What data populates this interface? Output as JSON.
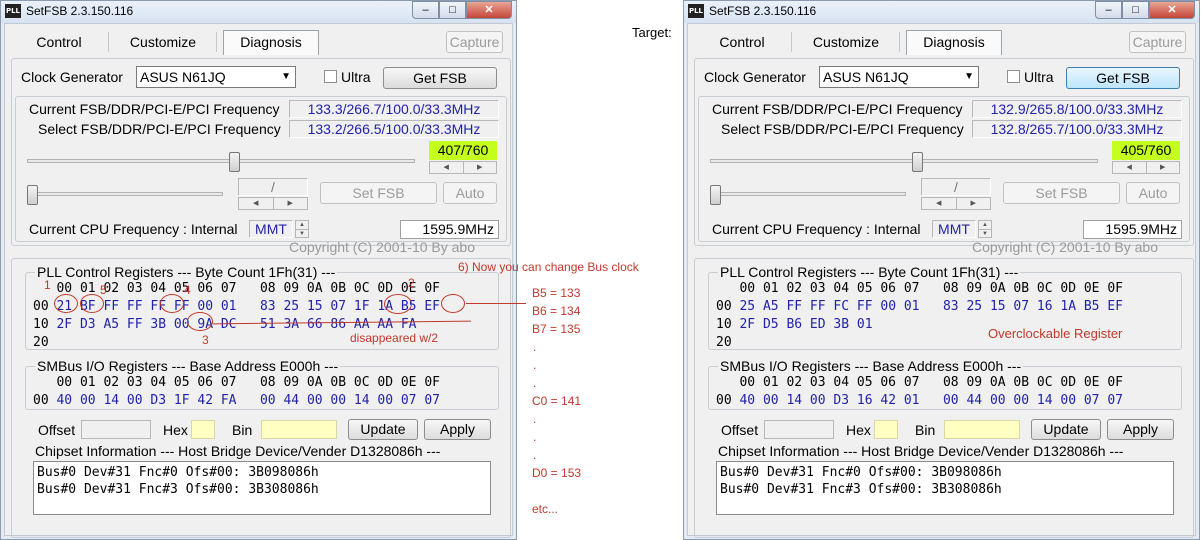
{
  "title_icon": "PLL",
  "window_title": "SetFSB 2.3.150.116",
  "target_label": "Target:",
  "tabs": [
    "Control",
    "Customize",
    "Diagnosis"
  ],
  "capture": "Capture",
  "clock_gen_label": "Clock Generator",
  "clock_gen_value": "ASUS N61JQ",
  "ultra_label": "Ultra",
  "get_fsb": "Get FSB",
  "cur_freq_label": "Current FSB/DDR/PCI-E/PCI Frequency",
  "sel_freq_label": "Select FSB/DDR/PCI-E/PCI Frequency",
  "slash": "/",
  "set_fsb": "Set FSB",
  "auto": "Auto",
  "cpu_label": "Current CPU Frequency : Internal",
  "mmt": "MMT",
  "copyright": "Copyright (C) 2001-10 By abo",
  "pll_header": "PLL Control Registers  --- Byte Count 1Fh(31) ---",
  "col_header": "   00 01 02 03 04 05 06 07   08 09 0A 0B 0C 0D 0E 0F",
  "smbus_header": "SMBus I/O Registers  --- Base Address E000h ---",
  "offset_label": "Offset",
  "hex_label": "Hex",
  "bin_label": "Bin",
  "update": "Update",
  "apply": "Apply",
  "chipset_header": "Chipset Information  --- Host Bridge Device/Vender D1328086h ---",
  "chipset_lines": [
    "Bus#0 Dev#31 Fnc#0 Ofs#00: 3B098086h",
    "Bus#0 Dev#31 Fnc#3 Ofs#00: 3B308086h"
  ],
  "left": {
    "cur_freq": "133.3/266.7/100.0/33.3MHz",
    "sel_freq": "133.2/266.5/100.0/33.3MHz",
    "fsb_count": "407/760",
    "cpu_freq": "1595.9MHz",
    "pll_rows": [
      {
        "addr": "00",
        "values": "21 BF FF FF FF FF 00 01   83 25 15 07 1F 1A B5 EF"
      },
      {
        "addr": "10",
        "values": "2F D3 A5 FF 3B 00 9A DC   51 3A 66 86 AA AA FA"
      },
      {
        "addr": "20",
        "values": ""
      }
    ],
    "smbus_row": {
      "addr": "00",
      "values": "40 00 14 00 D3 1F 42 FA   00 44 00 00 14 00 07 07"
    }
  },
  "right": {
    "cur_freq": "132.9/265.8/100.0/33.3MHz",
    "sel_freq": "132.8/265.7/100.0/33.3MHz",
    "fsb_count": "405/760",
    "cpu_freq": "1595.9MHz",
    "pll_rows": [
      {
        "addr": "00",
        "values": "25 A5 FF FF FC FF 00 01   83 25 15 07 16 1A B5 EF"
      },
      {
        "addr": "10",
        "values": "2F D5 B6 ED 3B 01"
      },
      {
        "addr": "20",
        "values": ""
      }
    ],
    "smbus_row": {
      "addr": "00",
      "values": "40 00 14 00 D3 16 42 01   00 44 00 00 14 00 07 07"
    }
  },
  "annotations": {
    "n1": "1",
    "n2": "2",
    "n3": "3",
    "n4": "4",
    "n5": "5",
    "step6": "6) Now you can change Bus clock",
    "disappeared": "disappeared w/2",
    "overclockable": "Overclockable Register",
    "b5": "B5 = 133",
    "b6": "B6 = 134",
    "b7": "B7 = 135",
    "dot": ".",
    "c0": "C0 = 141",
    "d0": "D0 = 153",
    "etc": "etc..."
  }
}
